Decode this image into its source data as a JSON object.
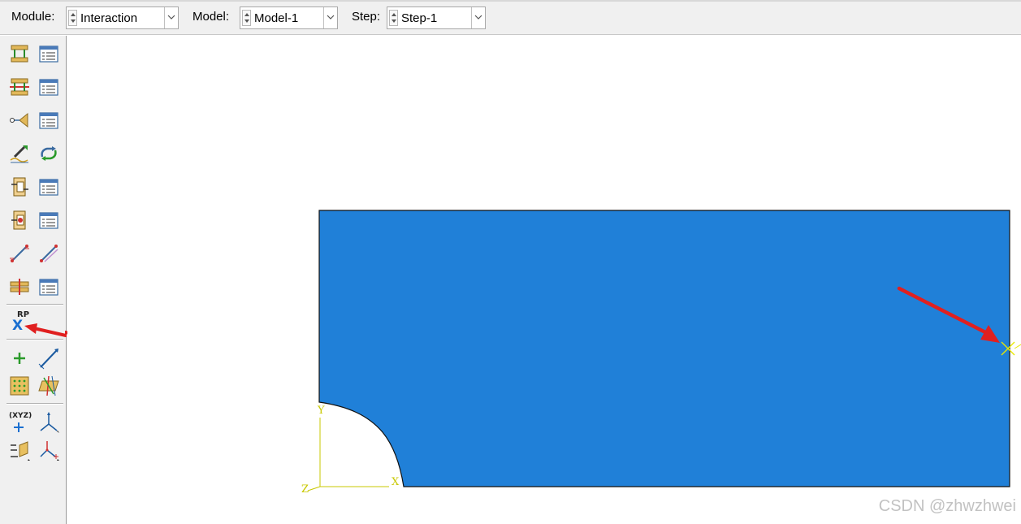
{
  "context_bar": {
    "module_label": "Module:",
    "module_value": "Interaction",
    "model_label": "Model:",
    "model_value": "Model-1",
    "step_label": "Step:",
    "step_value": "Step-1"
  },
  "toolbox": {
    "rp_label": "RP",
    "rp_mark": "X",
    "datum_csys_label": "(XYZ)"
  },
  "viewport": {
    "axis_y": "Y",
    "axis_x": "X",
    "axis_z": "Z",
    "part_color": "#2080d8",
    "rp_color": "#e8e800"
  },
  "watermark": "CSDN @zhwzhwei"
}
